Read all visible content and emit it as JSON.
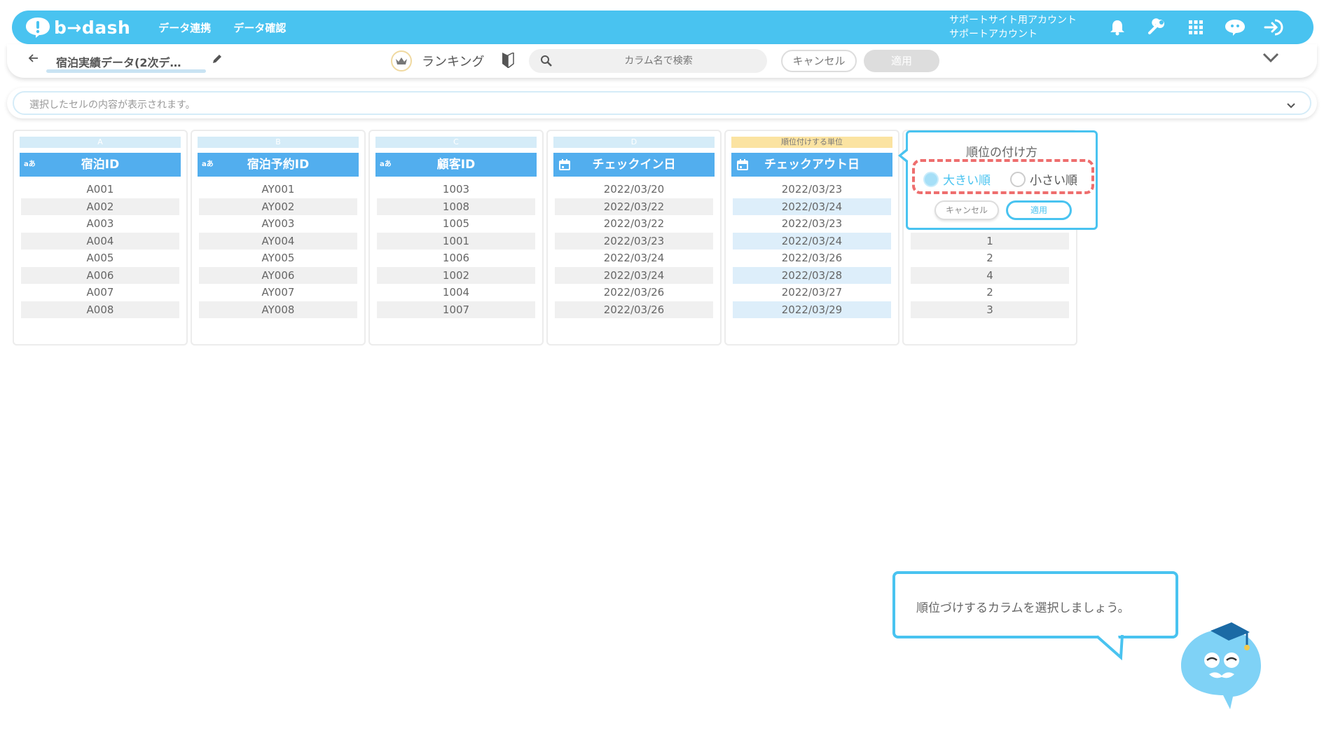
{
  "header": {
    "logo_text": "b→dash",
    "nav": [
      "データ連携",
      "データ確認"
    ],
    "account_line1": "サポートサイト用アカウント",
    "account_line2": "サポートアカウント",
    "icons": [
      "bell-icon",
      "wrench-icon",
      "apps-grid-icon",
      "chat-mascot-icon",
      "logout-icon"
    ]
  },
  "subbar": {
    "dataset_name": "宿泊実績データ(2次デ…",
    "mode_label": "ランキング",
    "search_placeholder": "カラム名で検索",
    "cancel_label": "キャンセル",
    "apply_label": "適用"
  },
  "cellbar": {
    "placeholder": "選択したセルの内容が表示されます。"
  },
  "columns": [
    {
      "letter": "A",
      "name": "宿泊ID",
      "type": "text",
      "type_label": "aあ",
      "values": [
        "A001",
        "A002",
        "A003",
        "A004",
        "A005",
        "A006",
        "A007",
        "A008"
      ]
    },
    {
      "letter": "B",
      "name": "宿泊予約ID",
      "type": "text",
      "type_label": "aあ",
      "values": [
        "AY001",
        "AY002",
        "AY003",
        "AY004",
        "AY005",
        "AY006",
        "AY007",
        "AY008"
      ]
    },
    {
      "letter": "C",
      "name": "顧客ID",
      "type": "text",
      "type_label": "aあ",
      "values": [
        "1003",
        "1008",
        "1005",
        "1001",
        "1006",
        "1002",
        "1004",
        "1007"
      ]
    },
    {
      "letter": "D",
      "name": "チェックイン日",
      "type": "date",
      "type_label": "",
      "values": [
        "2022/03/20",
        "2022/03/22",
        "2022/03/22",
        "2022/03/23",
        "2022/03/24",
        "2022/03/24",
        "2022/03/26",
        "2022/03/26"
      ]
    },
    {
      "letter": "順位付けする単位",
      "name": "チェックアウト日",
      "type": "date",
      "type_label": "",
      "rank_target": true,
      "values": [
        "2022/03/23",
        "2022/03/24",
        "2022/03/23",
        "2022/03/24",
        "2022/03/26",
        "2022/03/28",
        "2022/03/27",
        "2022/03/29"
      ]
    },
    {
      "letter": "",
      "name": "",
      "type": "rank",
      "type_label": "",
      "values": [
        "",
        "",
        "",
        "1",
        "2",
        "4",
        "2",
        "3"
      ]
    }
  ],
  "popup": {
    "title": "順位の付け方",
    "option_desc": "大きい順",
    "option_asc": "小さい順",
    "selected": "desc",
    "cancel_label": "キャンセル",
    "apply_label": "適用"
  },
  "guide": {
    "message": "順位づけするカラムを選択しましょう。"
  },
  "colors": {
    "brand": "#49c3f0",
    "header_cell": "#52aeee",
    "highlight": "#ee6e6e"
  }
}
